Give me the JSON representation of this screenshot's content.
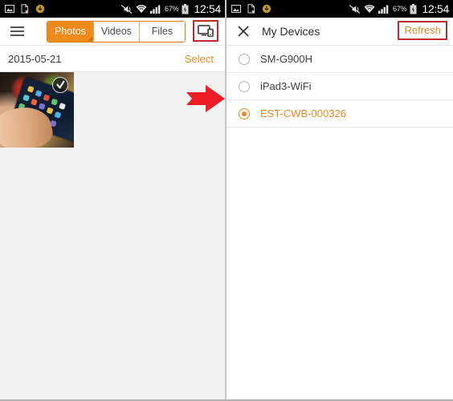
{
  "status_bar": {
    "icons_left": [
      "image-icon",
      "document-x-icon",
      "download-circle-icon"
    ],
    "icons_right": [
      "mute-vibrate-icon",
      "wifi-icon",
      "signal-bars-icon",
      "battery-icon"
    ],
    "battery_percent": "67%",
    "time": "12:54"
  },
  "left_panel": {
    "menu_icon": "hamburger-menu-icon",
    "tabs": [
      {
        "label": "Photos",
        "active": true
      },
      {
        "label": "Videos",
        "active": false
      },
      {
        "label": "Files",
        "active": false
      }
    ],
    "cast_icon": "cast-to-device-icon",
    "date": "2015-05-21",
    "select_label": "Select",
    "thumbnail": {
      "name": "photo-thumbnail",
      "badge_icon": "check-badge-icon"
    }
  },
  "annotation": {
    "arrow_icon": "red-right-arrow",
    "arrow_color": "#ee1c25",
    "highlight_color": "#c1272d"
  },
  "right_panel": {
    "close_icon": "close-x-icon",
    "title": "My Devices",
    "refresh_label": "Refresh",
    "devices": [
      {
        "name": "SM-G900H",
        "selected": false
      },
      {
        "name": "iPad3-WiFi",
        "selected": false
      },
      {
        "name": "EST-CWB-000326",
        "selected": true
      }
    ]
  },
  "colors": {
    "accent_orange": "#e98a28",
    "tab_orange": "#f08a1c",
    "annotation_red": "#c1272d",
    "arrow_red": "#ee1c25",
    "panel_bg": "#f2f2f2"
  }
}
